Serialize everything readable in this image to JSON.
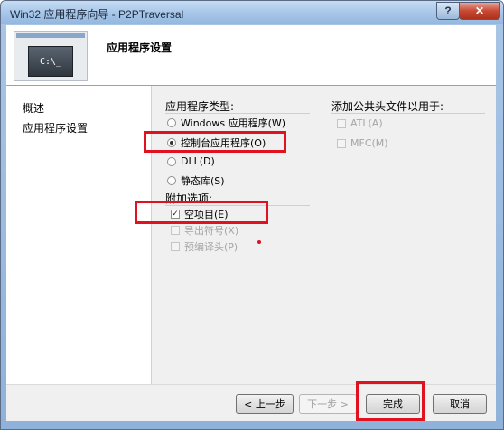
{
  "window": {
    "title": "Win32 应用程序向导 - P2PTraversal",
    "help_label": "?",
    "close_label": "✕"
  },
  "header": {
    "title": "应用程序设置",
    "console_text": "C:\\_"
  },
  "nav": {
    "items": [
      {
        "label": "概述"
      },
      {
        "label": "应用程序设置"
      }
    ]
  },
  "app_type": {
    "label": "应用程序类型:",
    "options": [
      {
        "label": "Windows 应用程序(W)",
        "checked": false
      },
      {
        "label": "控制台应用程序(O)",
        "checked": true
      },
      {
        "label": "DLL(D)",
        "checked": false
      },
      {
        "label": "静态库(S)",
        "checked": false
      }
    ]
  },
  "extra_options": {
    "label": "附加选项:",
    "items": [
      {
        "label": "空项目(E)",
        "checked": true,
        "enabled": true
      },
      {
        "label": "导出符号(X)",
        "checked": false,
        "enabled": false
      },
      {
        "label": "预编译头(P)",
        "checked": false,
        "enabled": false
      }
    ]
  },
  "common_headers": {
    "label": "添加公共头文件以用于:",
    "items": [
      {
        "label": "ATL(A)",
        "checked": false,
        "enabled": false
      },
      {
        "label": "MFC(M)",
        "checked": false,
        "enabled": false
      }
    ]
  },
  "footer": {
    "prev_label": "< 上一步",
    "next_label": "下一步 >",
    "finish_label": "完成",
    "cancel_label": "取消"
  },
  "colors": {
    "highlight": "#e0121f"
  }
}
